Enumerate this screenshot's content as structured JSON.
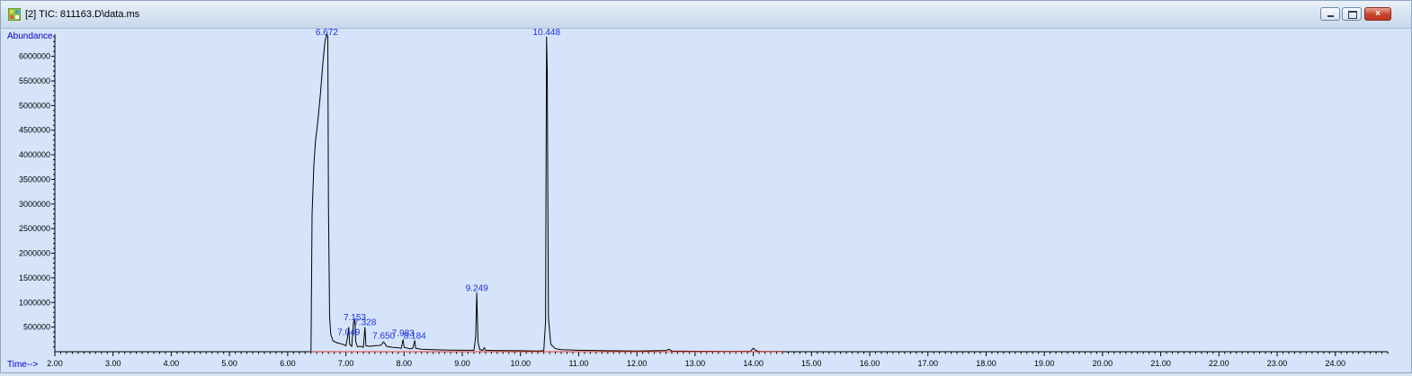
{
  "window": {
    "title": "[2] TIC: 811163.D\\data.ms",
    "buttons": {
      "minimize": "minimize",
      "maximize": "maximize",
      "close": "×"
    }
  },
  "chart_data": {
    "type": "line",
    "ylabel": "Abundance",
    "xlabel": "Time-->",
    "xlim": [
      2.0,
      24.9
    ],
    "ylim": [
      0,
      6450000
    ],
    "x_ticks": [
      "2.00",
      "3.00",
      "4.00",
      "5.00",
      "6.00",
      "7.00",
      "8.00",
      "9.00",
      "10.00",
      "11.00",
      "12.00",
      "13.00",
      "14.00",
      "15.00",
      "16.00",
      "17.00",
      "18.00",
      "19.00",
      "20.00",
      "21.00",
      "22.00",
      "23.00",
      "24.00"
    ],
    "y_ticks": [
      "500000",
      "1000000",
      "1500000",
      "2000000",
      "2500000",
      "3000000",
      "3500000",
      "4000000",
      "4500000",
      "5000000",
      "5500000",
      "6000000"
    ],
    "peak_labels": [
      {
        "text": "6.672",
        "x": 6.672,
        "y": 6400000
      },
      {
        "text": "10.448",
        "x": 10.448,
        "y": 6400000
      },
      {
        "text": "9.249",
        "x": 9.249,
        "y": 1200000
      },
      {
        "text": "7.153",
        "x": 7.153,
        "y": 600000
      },
      {
        "text": "7.328",
        "x": 7.328,
        "y": 500000
      },
      {
        "text": "7.049",
        "x": 7.049,
        "y": 300000
      },
      {
        "text": "7.650",
        "x": 7.65,
        "y": 230000
      },
      {
        "text": "7.983",
        "x": 7.983,
        "y": 280000
      },
      {
        "text": "8.184",
        "x": 8.184,
        "y": 230000
      }
    ],
    "series": [
      {
        "color": "#000000",
        "x": [
          6.4,
          6.42,
          6.45,
          6.48,
          6.52,
          6.56,
          6.6,
          6.64,
          6.66,
          6.672,
          6.69,
          6.7,
          6.72,
          6.74,
          6.78,
          6.85,
          6.95,
          7.0,
          7.03,
          7.049,
          7.065,
          7.1,
          7.13,
          7.153,
          7.17,
          7.2,
          7.25,
          7.3,
          7.328,
          7.345,
          7.4,
          7.5,
          7.6,
          7.65,
          7.7,
          7.8,
          7.9,
          7.95,
          7.983,
          8.0,
          8.1,
          8.15,
          8.184,
          8.2,
          8.3,
          8.5,
          8.7,
          9.0,
          9.2,
          9.23,
          9.249,
          9.27,
          9.3,
          9.35,
          9.38,
          9.4,
          9.5,
          10.0,
          10.3,
          10.4,
          10.43,
          10.448,
          10.46,
          10.48,
          10.52,
          10.6,
          10.7,
          11.0,
          11.5,
          12.0,
          12.5,
          12.55,
          12.6,
          13.0,
          13.5,
          13.95,
          14.0,
          14.05,
          14.1,
          14.5
        ],
        "y": [
          0,
          2800000,
          3800000,
          4300000,
          4700000,
          5200000,
          5800000,
          6300000,
          6400000,
          6450000,
          6400000,
          3000000,
          700000,
          350000,
          220000,
          180000,
          150000,
          120000,
          300000,
          500000,
          150000,
          110000,
          600000,
          650000,
          200000,
          100000,
          110000,
          90000,
          500000,
          120000,
          110000,
          120000,
          130000,
          200000,
          110000,
          90000,
          80000,
          70000,
          250000,
          90000,
          60000,
          70000,
          230000,
          70000,
          50000,
          40000,
          35000,
          30000,
          30000,
          300000,
          1200000,
          200000,
          40000,
          30000,
          80000,
          30000,
          25000,
          20000,
          15000,
          20000,
          600000,
          6400000,
          5700000,
          700000,
          150000,
          60000,
          40000,
          30000,
          20000,
          15000,
          25000,
          50000,
          15000,
          10000,
          8000,
          8000,
          70000,
          20000,
          8000,
          5000
        ]
      },
      {
        "color": "#e23a2e",
        "x": [
          6.4,
          14.5
        ],
        "y": [
          0,
          0
        ]
      }
    ]
  }
}
